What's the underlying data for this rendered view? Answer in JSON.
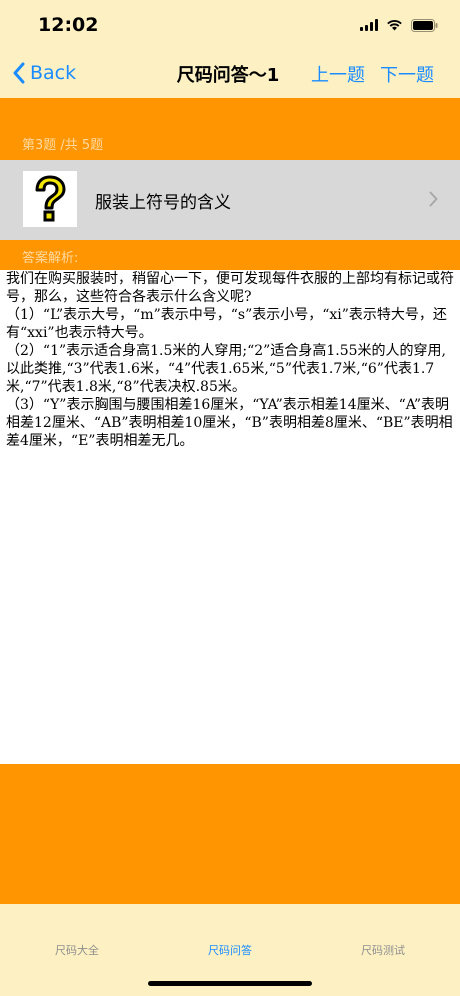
{
  "status": {
    "time": "12:02"
  },
  "nav": {
    "back_label": "Back",
    "title": "尺码问答～1",
    "prev_label": "上一题",
    "next_label": "下一题"
  },
  "progress": "第3题 /共 5题",
  "question": {
    "title": "服装上符号的含义"
  },
  "answer": {
    "label": "答案解析:",
    "paragraphs": [
      "我们在购买服装时，稍留心一下，便可发现每件衣服的上部均有标记或符号，那么，这些符合各表示什么含义呢?",
      "（1）“L”表示大号，“m”表示中号，“s”表示小号，“xi”表示特大号，还有“xxi”也表示特大号。",
      "（2）“1”表示适合身高1.5米的人穿用;“2”适合身高1.55米的人的穿用,以此类推,“3”代表1.6米，“4”代表1.65米,“5”代表1.7米,“6”代表1.7米,“7”代表1.8米,“8”代表决权.85米。",
      "（3）“Y”表示胸围与腰围相差16厘米，“YA”表示相差14厘米、“A”表明相差12厘米、“AB”表明相差10厘米，“B”表明相差8厘米、“BE”表明相差4厘米，“E”表明相差无几。"
    ]
  },
  "tabs": [
    {
      "label": "尺码大全",
      "active": false
    },
    {
      "label": "尺码问答",
      "active": true
    },
    {
      "label": "尺码测试",
      "active": false
    }
  ],
  "colors": {
    "accent": "#1a8cff",
    "orange": "#ff9500",
    "bar_background": "#fdf1c3",
    "question_background": "#d8d8d8"
  }
}
